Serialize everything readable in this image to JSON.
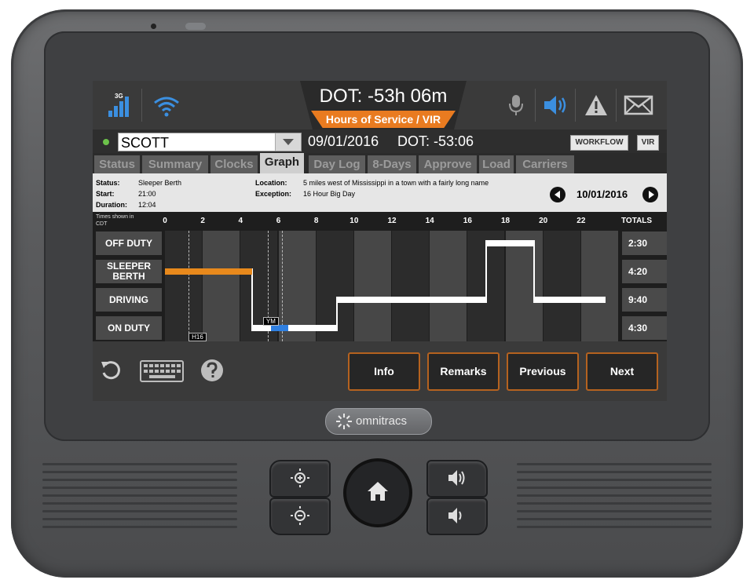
{
  "header": {
    "network": "3G",
    "dot_clock": "DOT: -53h 06m",
    "mode_label": "Hours of Service / VIR",
    "icons": [
      "signal-icon",
      "wifi-icon",
      "microphone-icon",
      "speaker-icon",
      "warning-icon",
      "mail-icon"
    ]
  },
  "driver": {
    "status_color": "#6cc24a",
    "name": "SCOTT",
    "date": "09/01/2016",
    "dot": "DOT: -53:06",
    "workflow_label": "WORKFLOW",
    "vir_label": "VIR"
  },
  "tabs": [
    {
      "label": "Status",
      "active": false
    },
    {
      "label": "Summary",
      "active": false
    },
    {
      "label": "Clocks",
      "active": false
    },
    {
      "label": "Graph",
      "active": true
    },
    {
      "label": "Day Log",
      "active": false
    },
    {
      "label": "8-Days",
      "active": false
    },
    {
      "label": "Approve",
      "active": false
    },
    {
      "label": "Load",
      "active": false
    },
    {
      "label": "Carriers",
      "active": false
    }
  ],
  "info": {
    "status_label": "Status:",
    "status_value": "Sleeper Berth",
    "start_label": "Start:",
    "start_value": "21:00",
    "duration_label": "Duration:",
    "duration_value": "12:04",
    "location_label": "Location:",
    "location_value": "5 miles west of Mississippi in a town with a fairly long name",
    "exception_label": "Exception:",
    "exception_value": "16 Hour Big Day",
    "nav_date": "10/01/2016"
  },
  "graph": {
    "tz_note_1": "Times shown in",
    "tz_note_2": "CDT",
    "hours": [
      "0",
      "2",
      "4",
      "6",
      "8",
      "10",
      "12",
      "14",
      "16",
      "18",
      "20",
      "22"
    ],
    "totals_label": "TOTALS",
    "rows": [
      {
        "label_1": "OFF DUTY",
        "label_2": "",
        "total": "2:30"
      },
      {
        "label_1": "SLEEPER",
        "label_2": "BERTH",
        "total": "4:20"
      },
      {
        "label_1": "DRIVING",
        "label_2": "",
        "total": "9:40"
      },
      {
        "label_1": "ON DUTY",
        "label_2": "",
        "total": "4:30"
      }
    ],
    "segments": [
      {
        "row": 1,
        "start": 0.0,
        "end": 4.6,
        "color": "#e8891c"
      },
      {
        "row": 3,
        "start": 4.6,
        "end": 5.6,
        "color": "#ffffff"
      },
      {
        "row": 3,
        "start": 5.6,
        "end": 6.5,
        "color": "#2f7fe0"
      },
      {
        "row": 3,
        "start": 6.5,
        "end": 9.1,
        "color": "#ffffff"
      },
      {
        "row": 2,
        "start": 9.1,
        "end": 17.0,
        "color": "#ffffff"
      },
      {
        "row": 0,
        "start": 17.0,
        "end": 19.5,
        "color": "#ffffff"
      },
      {
        "row": 2,
        "start": 19.5,
        "end": 23.3,
        "color": "#ffffff"
      }
    ],
    "transitions": [
      {
        "at": 4.6,
        "from": 1,
        "to": 3
      },
      {
        "at": 9.1,
        "from": 3,
        "to": 2
      },
      {
        "at": 17.0,
        "from": 2,
        "to": 0
      },
      {
        "at": 19.5,
        "from": 0,
        "to": 2
      }
    ],
    "markers": [
      {
        "label": "H16",
        "at": 1.25
      },
      {
        "label": "YM",
        "at": 5.6
      }
    ],
    "marker_lines": [
      1.25,
      5.45,
      6.2
    ]
  },
  "bottom": {
    "info_label": "Info",
    "remarks_label": "Remarks",
    "previous_label": "Previous",
    "next_label": "Next"
  },
  "brand": "omnitracs"
}
